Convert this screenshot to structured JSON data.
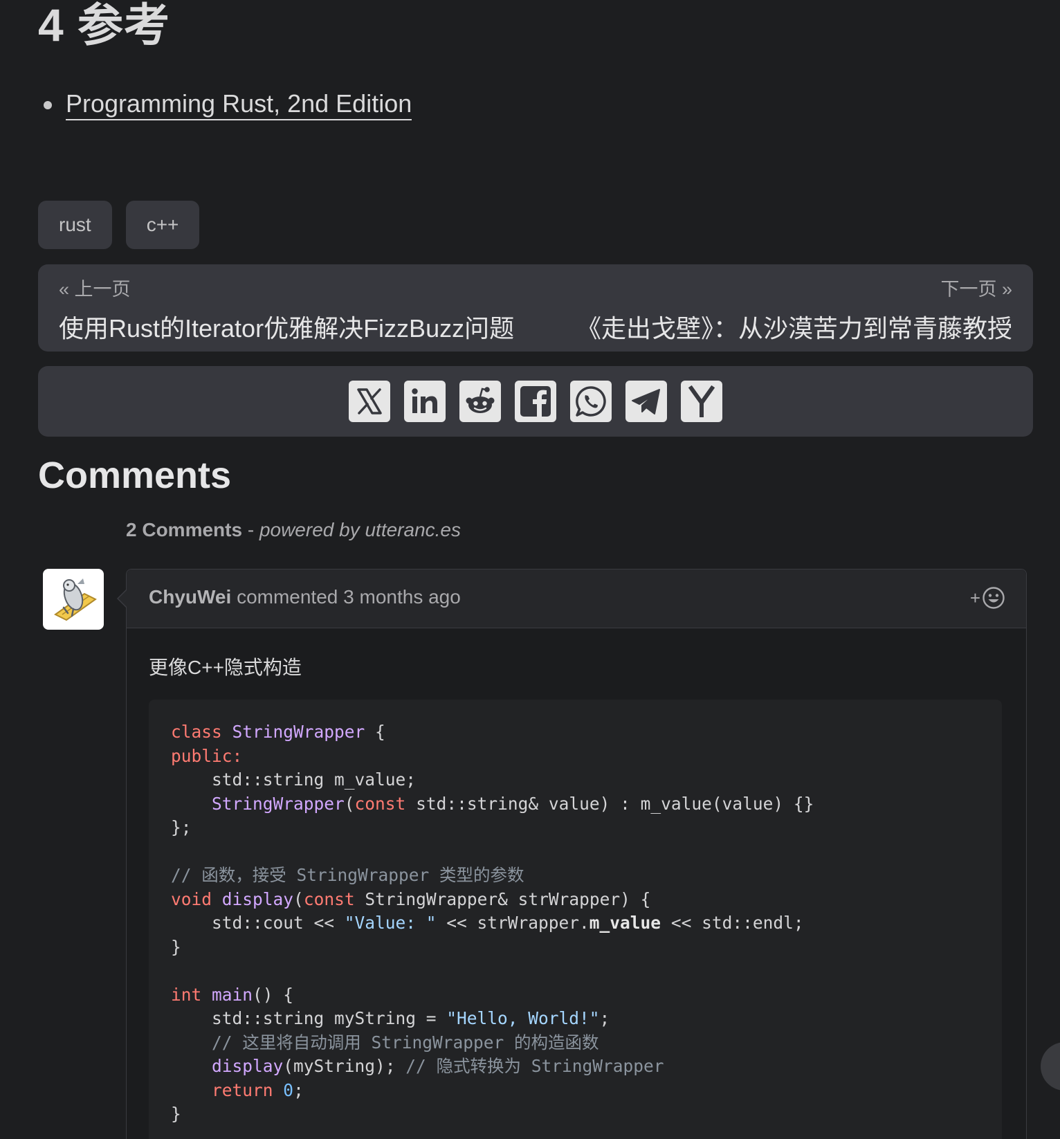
{
  "section": {
    "heading": "4 参考"
  },
  "references": [
    {
      "label": "Programming Rust, 2nd Edition"
    }
  ],
  "tags": [
    "rust",
    "c++"
  ],
  "pager": {
    "prev_label": "« 上一页",
    "prev_title": "使用Rust的Iterator优雅解决FizzBuzz问题",
    "next_label": "下一页 »",
    "next_title": "《走出戈壁》：从沙漠苦力到常青藤教授"
  },
  "share": {
    "icons": [
      "x-icon",
      "linkedin-icon",
      "reddit-icon",
      "facebook-icon",
      "whatsapp-icon",
      "telegram-icon",
      "ycombinator-icon"
    ]
  },
  "comments": {
    "heading": "Comments",
    "count_text": "2 Comments",
    "powered_text": "powered by utteranc.es",
    "items": [
      {
        "author": "ChyuWei",
        "action": "commented",
        "time": "3 months ago",
        "reaction_label": "+",
        "text": "更像C++隐式构造"
      }
    ]
  },
  "colors": {
    "background": "#1d1e20",
    "panel": "#37383e",
    "keyword": "#ff7b72",
    "function": "#d2a8ff",
    "string": "#a5d6ff",
    "comment": "#8b949e"
  }
}
